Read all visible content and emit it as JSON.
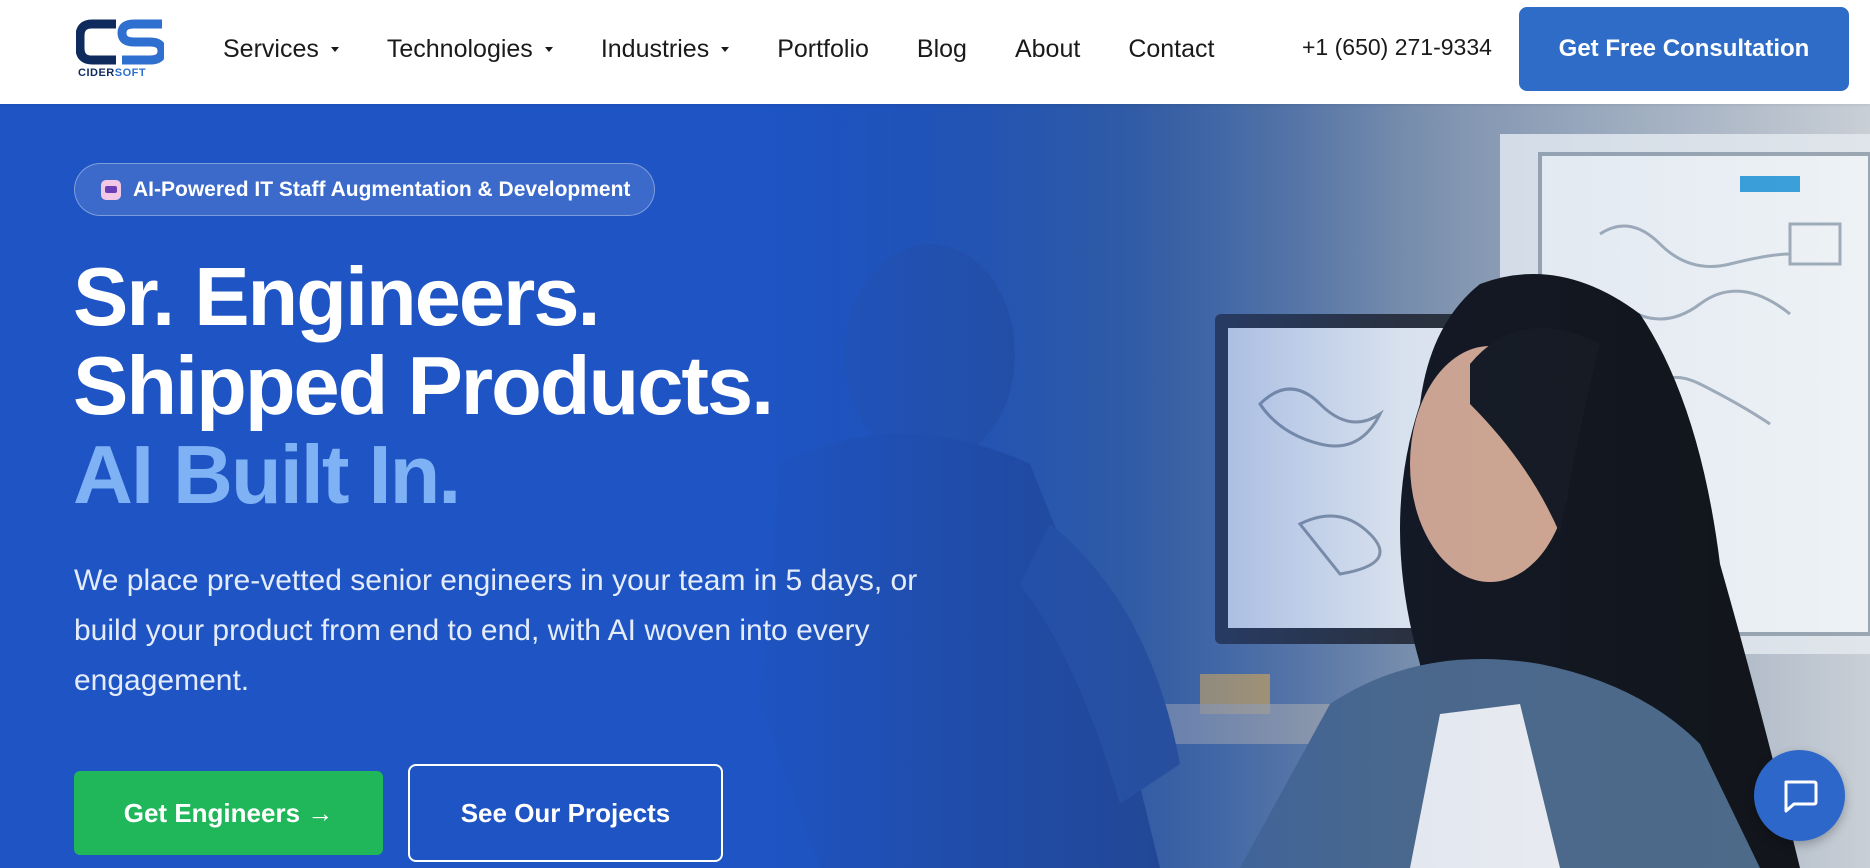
{
  "brand": {
    "logo_mark": "CS",
    "name_part1": "CIDER",
    "name_part2": "SOFT",
    "primary_color": "#2e6cc8",
    "dark_color": "#0f2a5c"
  },
  "nav": {
    "items": [
      {
        "label": "Services",
        "has_dropdown": true
      },
      {
        "label": "Technologies",
        "has_dropdown": true
      },
      {
        "label": "Industries",
        "has_dropdown": true
      },
      {
        "label": "Portfolio",
        "has_dropdown": false
      },
      {
        "label": "Blog",
        "has_dropdown": false
      },
      {
        "label": "About",
        "has_dropdown": false
      },
      {
        "label": "Contact",
        "has_dropdown": false
      }
    ],
    "phone": "+1 (650) 271-9334",
    "cta_label": "Get Free Consultation"
  },
  "hero": {
    "badge_icon": "robot-icon",
    "badge_text": "AI-Powered IT Staff Augmentation & Development",
    "headline_line1": "Sr. Engineers.",
    "headline_line2": "Shipped Products.",
    "headline_line3": "AI Built In.",
    "subtext": "We place pre-vetted senior engineers in your team in 5 days, or build your product from end to end, with AI woven into every engagement.",
    "primary_button": "Get Engineers →",
    "secondary_button": "See Our Projects",
    "accent_color": "#7fb2f5",
    "primary_button_color": "#20b65a",
    "background_color": "#1f55c4"
  },
  "chat": {
    "icon": "chat-bubble-icon"
  }
}
